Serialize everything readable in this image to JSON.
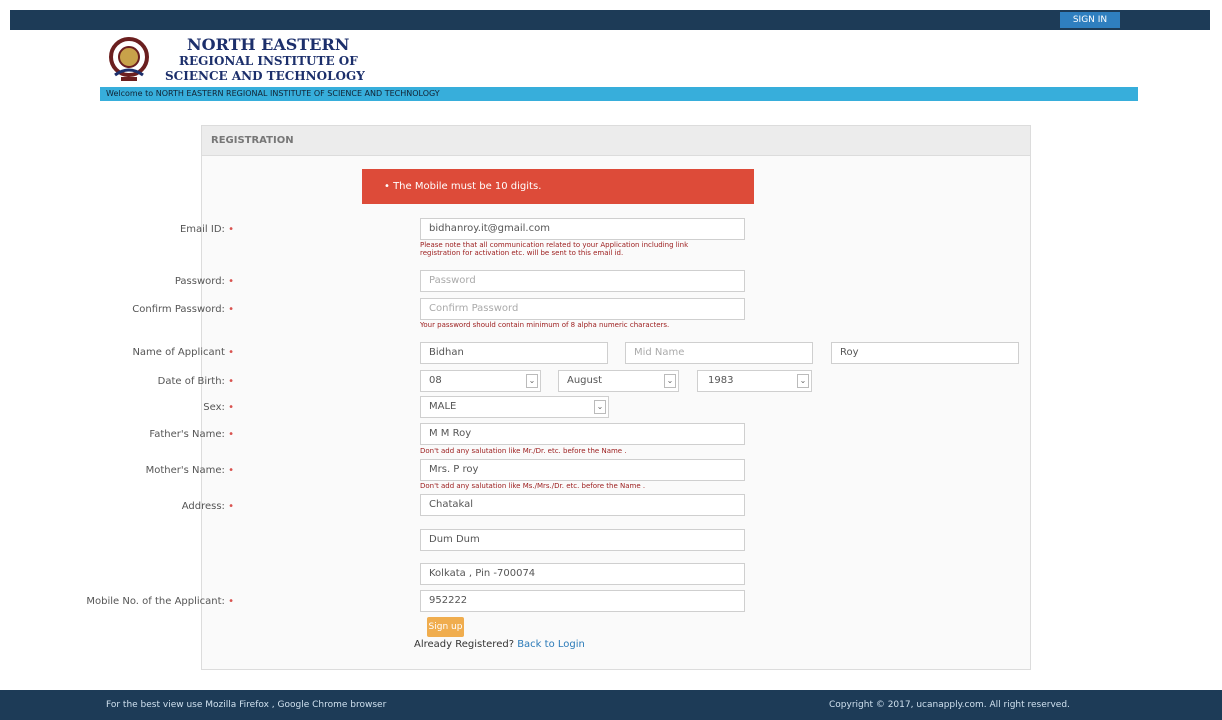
{
  "header": {
    "signin_label": "SIGN IN",
    "institute_line1": "NORTH EASTERN",
    "institute_line2": "REGIONAL INSTITUTE OF",
    "institute_line3": "SCIENCE AND TECHNOLOGY",
    "welcome_text": "Welcome to NORTH EASTERN REGIONAL INSTITUTE OF SCIENCE AND TECHNOLOGY"
  },
  "panel": {
    "title": "REGISTRATION",
    "alert_message": "• The Mobile must be 10 digits."
  },
  "form": {
    "email_label": "Email ID:",
    "email_value": "bidhanroy.it@gmail.com",
    "email_hint": "Please note that all communication related to your Application including link registration for activation etc. will be sent to this email id.",
    "password_label": "Password:",
    "password_placeholder": "Password",
    "confirm_label": "Confirm Password:",
    "confirm_placeholder": "Confirm Password",
    "password_hint": "Your password should contain minimum of 8 alpha numeric characters.",
    "name_label": "Name of Applicant",
    "first_name": "Bidhan",
    "mid_name_placeholder": "Mid Name",
    "last_name": "Roy",
    "dob_label": "Date of Birth:",
    "dob_day": "08",
    "dob_month": "August",
    "dob_year": "1983",
    "sex_label": "Sex:",
    "sex_value": "MALE",
    "father_label": "Father's Name:",
    "father_value": "M M Roy",
    "father_hint": "Don't add any salutation like Mr./Dr. etc. before the Name .",
    "mother_label": "Mother's Name:",
    "mother_value": "Mrs.  P roy",
    "mother_hint": "Don't add any salutation like Ms./Mrs./Dr. etc. before the Name .",
    "address_label": "Address:",
    "address_line1": "Chatakal",
    "address_line2": "Dum Dum",
    "address_line3": "Kolkata , Pin -700074",
    "mobile_label": "Mobile No. of the Applicant:",
    "mobile_value": "952222",
    "signup_label": "Sign up",
    "already_text": "Already Registered?",
    "back_link": "Back to Login"
  },
  "footer": {
    "left_text": "For the best view use Mozilla Firefox , Google Chrome browser",
    "right_text": "Copyright © 2017, ucanapply.com. All right reserved."
  }
}
